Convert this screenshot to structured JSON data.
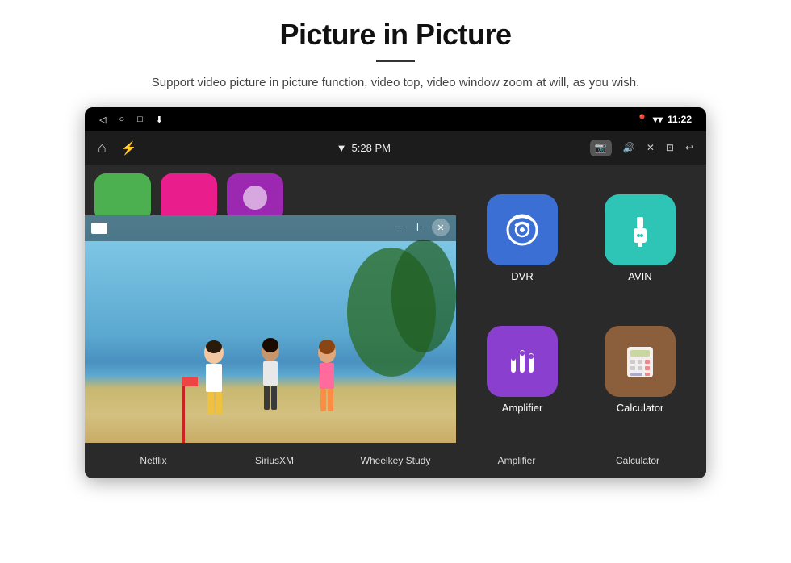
{
  "header": {
    "title": "Picture in Picture",
    "subtitle": "Support video picture in picture function, video top, video window zoom at will, as you wish."
  },
  "status_bar": {
    "time": "11:22",
    "nav_time": "5:28 PM",
    "back_icon": "◁",
    "home_icon": "○",
    "recents_icon": "□",
    "download_icon": "⬇"
  },
  "bottom_labels": {
    "netflix": "Netflix",
    "siriusxm": "SiriusXM",
    "wheelkey": "Wheelkey Study",
    "amplifier": "Amplifier",
    "calculator": "Calculator"
  },
  "apps": {
    "dvr": {
      "label": "DVR"
    },
    "avin": {
      "label": "AVIN"
    },
    "amplifier": {
      "label": "Amplifier"
    },
    "calculator": {
      "label": "Calculator"
    }
  }
}
